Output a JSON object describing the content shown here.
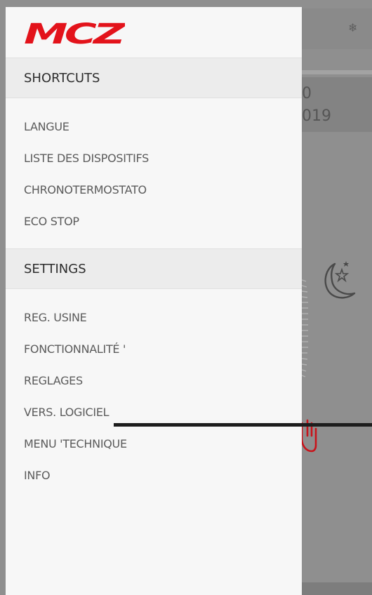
{
  "app": {
    "logo_text": "MCZ",
    "brand_color": "#e3131b"
  },
  "background": {
    "date_line1": "0",
    "date_line2": "019",
    "snowflake_icon": "snowflake-icon",
    "moon_icon": "moon-stars-icon",
    "hand_icon": "hand-icon"
  },
  "drawer": {
    "shortcuts": {
      "title": "SHORTCUTS",
      "items": [
        {
          "label": "LANGUE"
        },
        {
          "label": "LISTE DES DISPOSITIFS"
        },
        {
          "label": "CHRONOTERMOSTATO"
        },
        {
          "label": "ECO STOP"
        }
      ]
    },
    "settings": {
      "title": "SETTINGS",
      "items": [
        {
          "label": "REG. USINE"
        },
        {
          "label": "FONCTIONNALITÉ '"
        },
        {
          "label": "REGLAGES"
        },
        {
          "label": "VERS. LOGICIEL"
        },
        {
          "label": "MENU 'TECHNIQUE"
        },
        {
          "label": "INFO"
        }
      ]
    }
  }
}
